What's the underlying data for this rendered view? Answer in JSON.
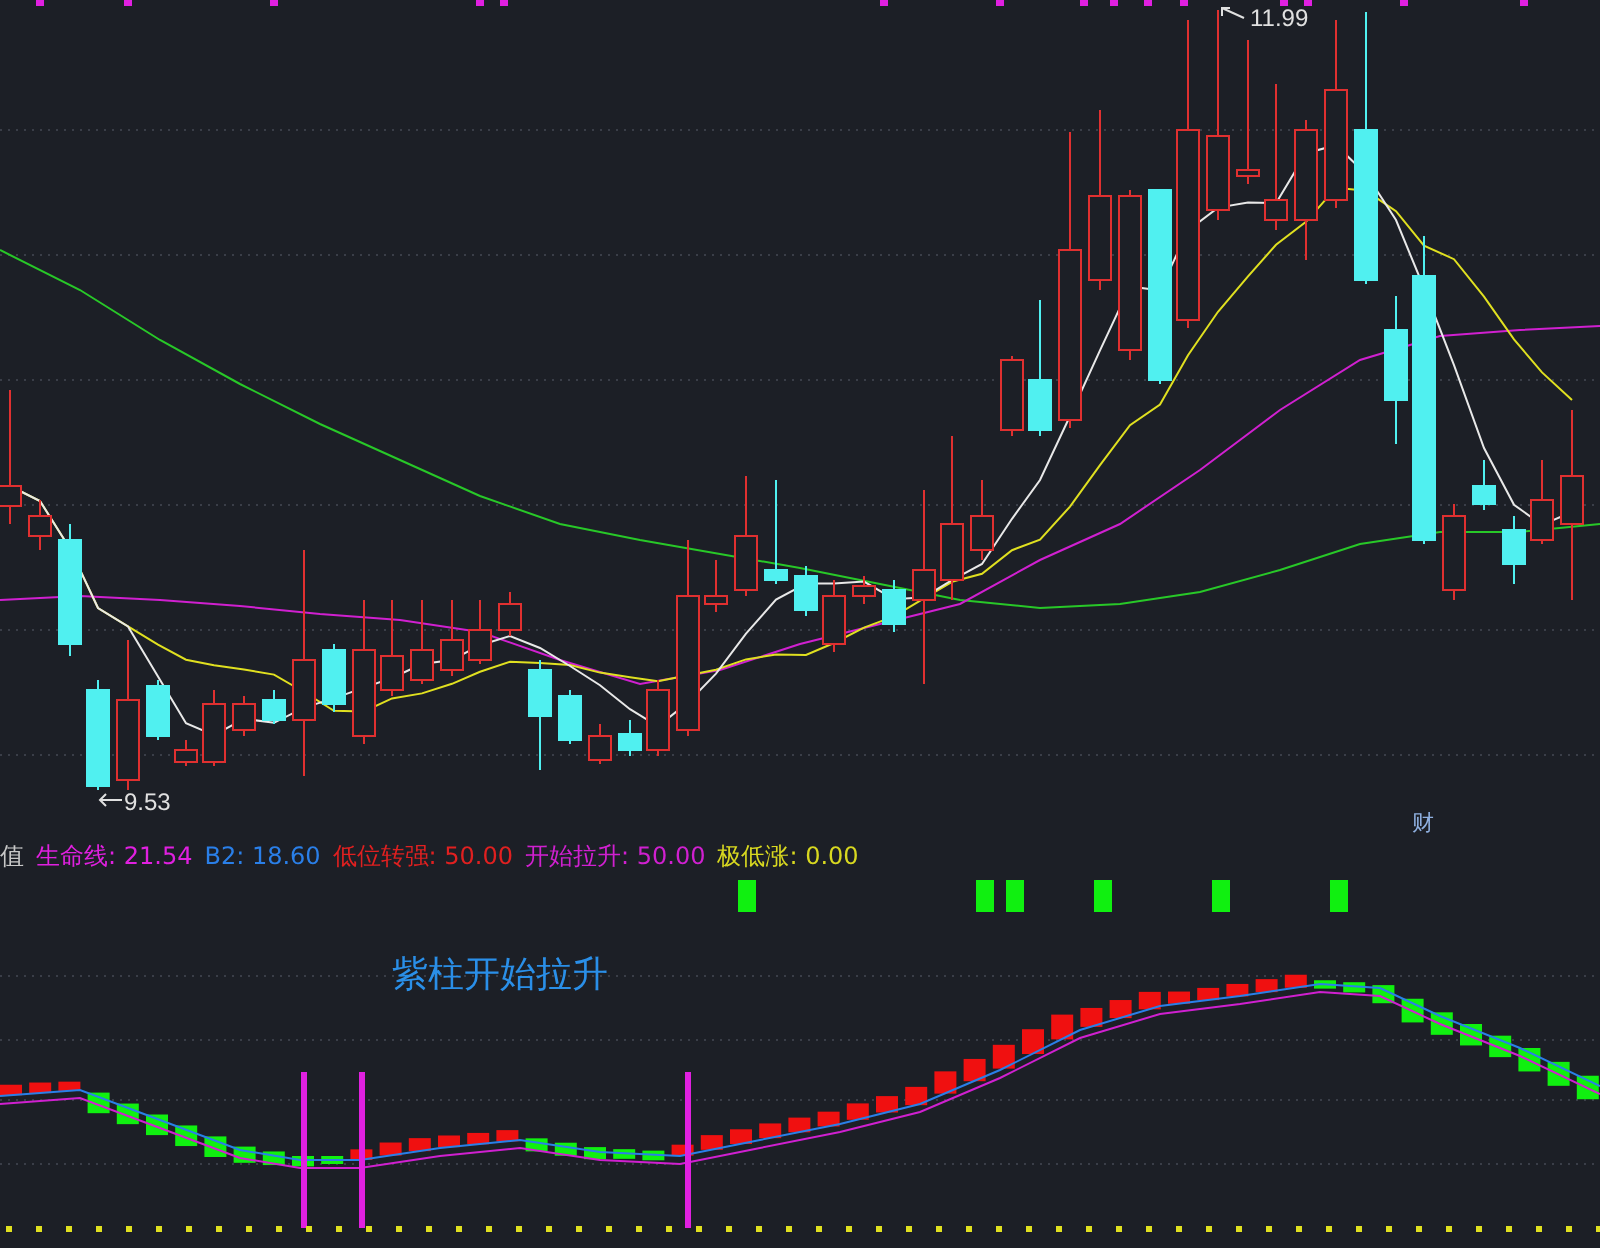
{
  "price_panel": {
    "high_label": "11.99",
    "low_label": "9.53",
    "marker_label": "财"
  },
  "indicator_legend": [
    {
      "label": "值",
      "color": "#c8c8c8"
    },
    {
      "label": "生命线: 21.54",
      "color": "#e020e0"
    },
    {
      "label": "B2: 18.60",
      "color": "#2a7fe8"
    },
    {
      "label": "低位转强: 50.00",
      "color": "#e02020"
    },
    {
      "label": "开始拉升: 50.00",
      "color": "#d020d0"
    },
    {
      "label": "极低涨: 0.00",
      "color": "#d8d820"
    }
  ],
  "indicator_panel": {
    "annotation": "紫柱开始拉升"
  }
}
